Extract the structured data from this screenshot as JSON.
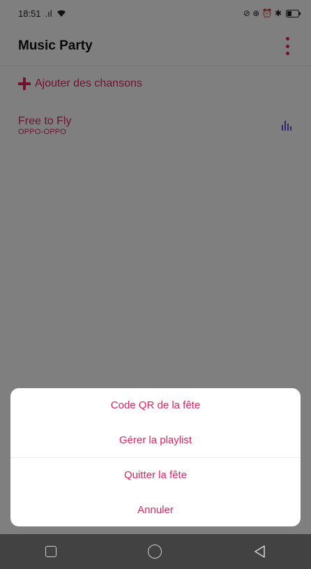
{
  "status": {
    "time": "18:51",
    "signal": ".ıl",
    "right_icons": "⊘ ⊕ ⏰ ✱"
  },
  "app": {
    "title": "Music Party"
  },
  "add_songs": {
    "label": "Ajouter des chansons"
  },
  "song": {
    "title": "Free to Fly",
    "artist": "OPPO-OPPO"
  },
  "sheet": {
    "items": [
      {
        "label": "Code QR de la fête"
      },
      {
        "label": "Gérer la playlist"
      },
      {
        "label": "Quitter la fête"
      },
      {
        "label": "Annuler"
      }
    ]
  },
  "colors": {
    "accent": "#e0245e",
    "equalizer": "#6d4bd8"
  }
}
